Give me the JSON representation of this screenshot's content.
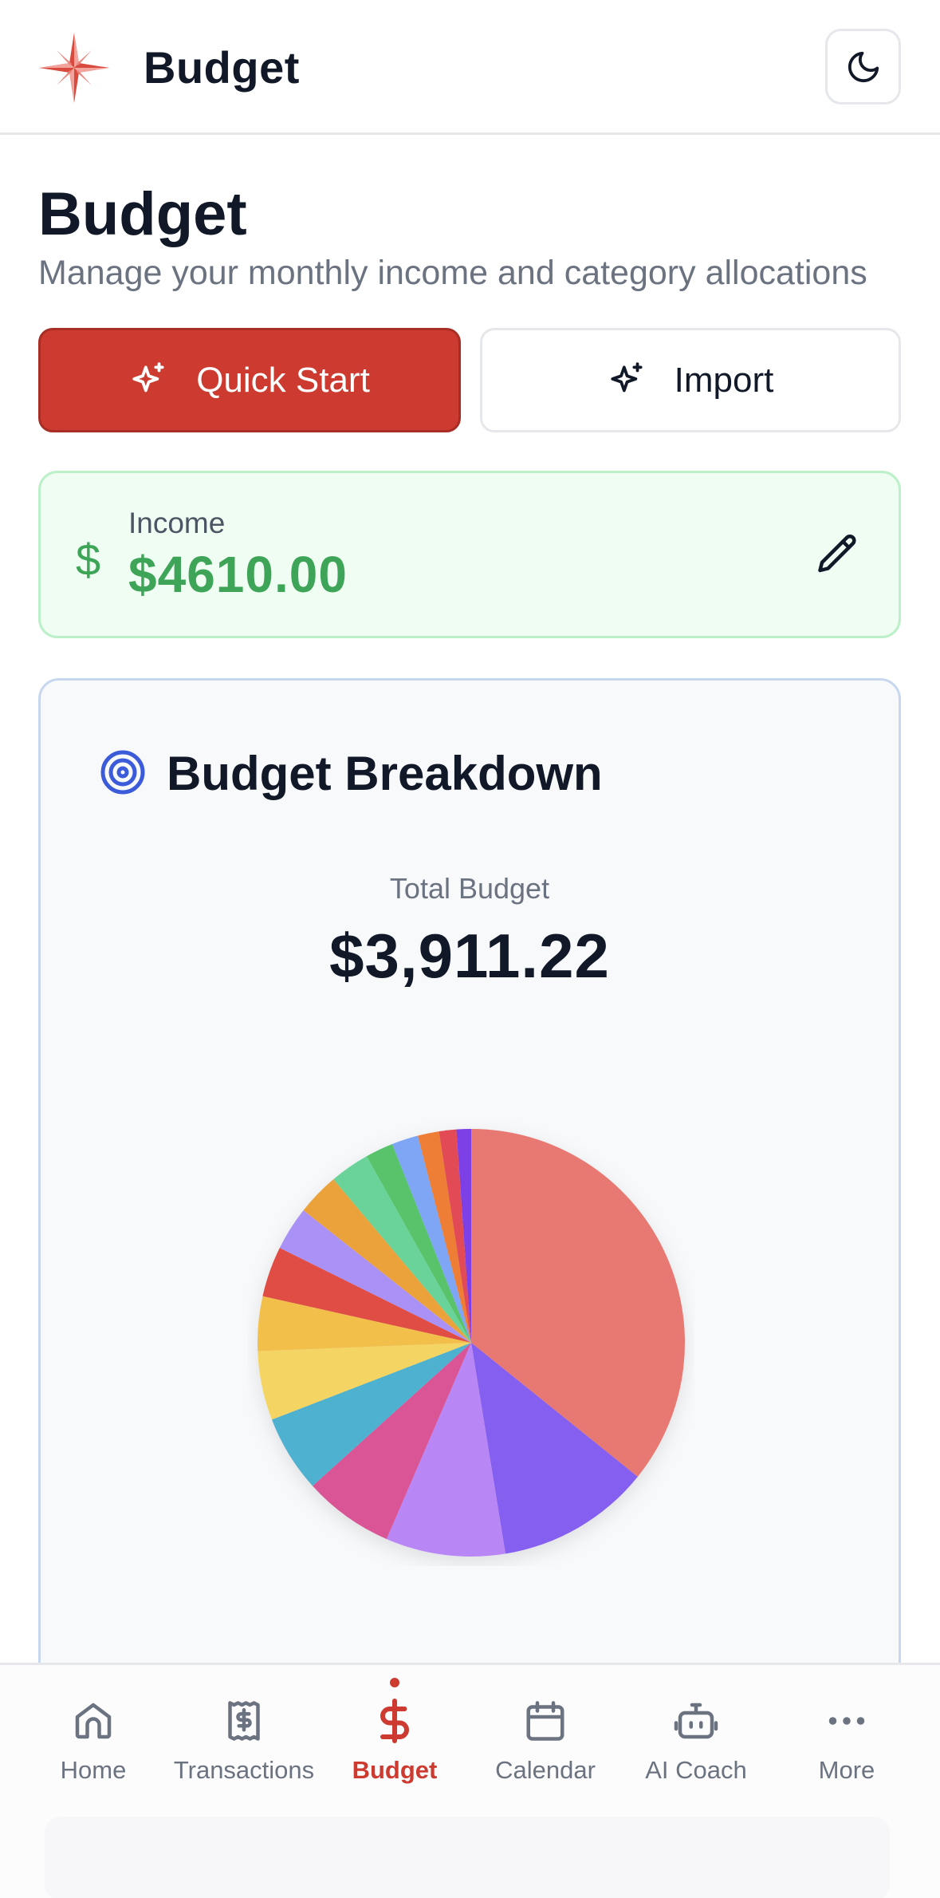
{
  "header": {
    "app_title": "Budget",
    "logo_icon": "compass-star-icon",
    "theme_icon": "moon-icon"
  },
  "page": {
    "title": "Budget",
    "subtitle": "Manage your monthly income and category allocations"
  },
  "actions": {
    "quick_start_label": "Quick Start",
    "import_label": "Import",
    "icon": "sparkles-icon"
  },
  "income": {
    "symbol": "$",
    "label": "Income",
    "value": "$4610.00",
    "edit_icon": "pencil-icon"
  },
  "breakdown": {
    "title": "Budget Breakdown",
    "icon": "target-icon",
    "total_label": "Total Budget",
    "total_value": "$3,911.22"
  },
  "chart_data": {
    "type": "pie",
    "slices": [
      {
        "color": "#e77872",
        "percent": 35.6
      },
      {
        "color": "#855ef0",
        "percent": 11.6
      },
      {
        "color": "#b886f5",
        "percent": 9.0
      },
      {
        "color": "#da5596",
        "percent": 6.8
      },
      {
        "color": "#4eb1cf",
        "percent": 5.8
      },
      {
        "color": "#f4d464",
        "percent": 5.2
      },
      {
        "color": "#f2bf4b",
        "percent": 4.1
      },
      {
        "color": "#df4d44",
        "percent": 3.8
      },
      {
        "color": "#a991f5",
        "percent": 3.3
      },
      {
        "color": "#eca23a",
        "percent": 3.2
      },
      {
        "color": "#6bd399",
        "percent": 3.0
      },
      {
        "color": "#59c36a",
        "percent": 2.1
      },
      {
        "color": "#7ea6f4",
        "percent": 2.0
      },
      {
        "color": "#ee7d35",
        "percent": 1.6
      },
      {
        "color": "#e24b55",
        "percent": 1.3
      },
      {
        "color": "#7b3fe6",
        "percent": 1.1
      }
    ]
  },
  "nav": {
    "items": [
      {
        "label": "Home",
        "icon": "home-icon"
      },
      {
        "label": "Transactions",
        "icon": "receipt-icon"
      },
      {
        "label": "Budget",
        "icon": "dollar-icon"
      },
      {
        "label": "Calendar",
        "icon": "calendar-icon"
      },
      {
        "label": "AI Coach",
        "icon": "robot-icon"
      },
      {
        "label": "More",
        "icon": "more-icon"
      }
    ],
    "active": "Budget"
  },
  "colors": {
    "accent": "#cc3a30",
    "income_green": "#3ea558",
    "target_blue": "#3b5bdb"
  }
}
